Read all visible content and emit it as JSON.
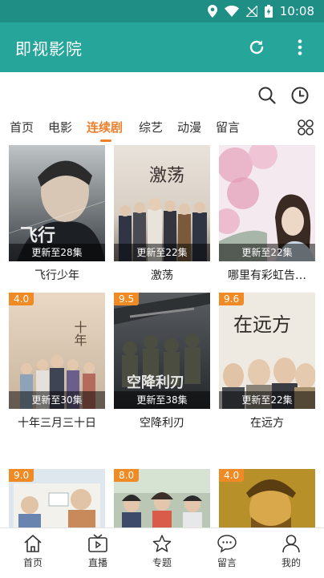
{
  "status": {
    "time": "10:08"
  },
  "appbar": {
    "title": "即视影院"
  },
  "tabs": [
    {
      "label": "首页",
      "active": false
    },
    {
      "label": "电影",
      "active": false
    },
    {
      "label": "连续剧",
      "active": true
    },
    {
      "label": "综艺",
      "active": false
    },
    {
      "label": "动漫",
      "active": false
    },
    {
      "label": "留言",
      "active": false
    }
  ],
  "cards": [
    {
      "title": "飞行少年",
      "status": "更新至28集",
      "badge": ""
    },
    {
      "title": "激荡",
      "status": "更新至22集",
      "badge": ""
    },
    {
      "title": "哪里有彩虹告…",
      "status": "更新至22集",
      "badge": ""
    },
    {
      "title": "十年三月三十日",
      "status": "更新至30集",
      "badge": "4.0"
    },
    {
      "title": "空降利刃",
      "status": "更新至38集",
      "badge": "9.5"
    },
    {
      "title": "在远方",
      "status": "更新至22集",
      "badge": "9.6"
    },
    {
      "title": "",
      "status": "",
      "badge": "9.0"
    },
    {
      "title": "",
      "status": "",
      "badge": "8.0"
    },
    {
      "title": "",
      "status": "",
      "badge": "4.0"
    }
  ],
  "poster_texts": {
    "p2": "激荡",
    "p4": "十年",
    "p5": "空降利刃",
    "p6": "在远方"
  },
  "bottomnav": [
    {
      "label": "首页",
      "icon": "home-icon"
    },
    {
      "label": "直播",
      "icon": "tv-icon"
    },
    {
      "label": "专题",
      "icon": "star-icon"
    },
    {
      "label": "留言",
      "icon": "chat-icon"
    },
    {
      "label": "我的",
      "icon": "person-icon"
    }
  ],
  "colors": {
    "primary": "#26a69a",
    "statusbar": "#1f8f86",
    "accent": "#f07f2c"
  }
}
